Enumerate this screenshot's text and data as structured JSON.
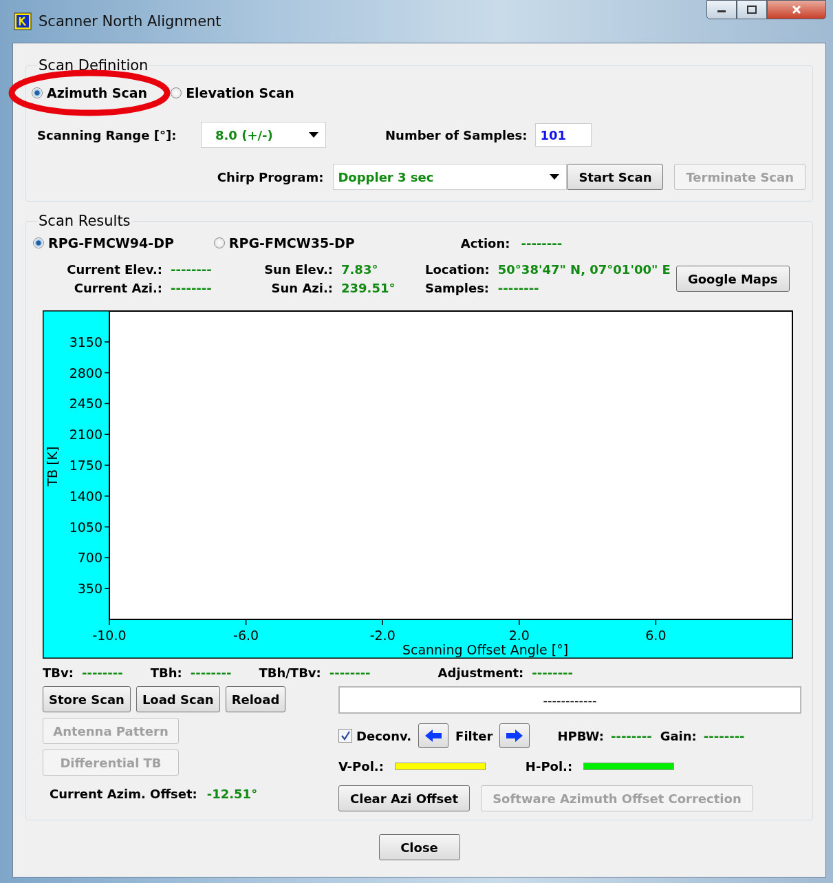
{
  "window": {
    "title": "Scanner North Alignment"
  },
  "highlight": {
    "kind": "ellipse"
  },
  "scan_definition": {
    "title": "Scan Definition",
    "scan_types": [
      {
        "label": "Azimuth Scan",
        "selected": true
      },
      {
        "label": "Elevation Scan",
        "selected": false
      }
    ],
    "scanning_range": {
      "label": "Scanning Range [°]:",
      "value": "8.0 (+/-)"
    },
    "samples": {
      "label": "Number of Samples:",
      "value": "101"
    },
    "chirp_program": {
      "label": "Chirp Program:",
      "value": "Doppler 3 sec"
    },
    "buttons": [
      {
        "label": "Start Scan",
        "disabled": false
      },
      {
        "label": "Terminate Scan",
        "disabled": true
      }
    ]
  },
  "scan_results": {
    "title": "Scan Results",
    "instruments": [
      {
        "label": "RPG-FMCW94-DP",
        "selected": true
      },
      {
        "label": "RPG-FMCW35-DP",
        "selected": false
      }
    ],
    "action": {
      "label": "Action:",
      "value": "--------"
    },
    "readout_rows": [
      [
        {
          "label": "Current Elev.:",
          "value": "--------"
        },
        {
          "label": "Sun Elev.:",
          "value": "7.83°"
        },
        {
          "label": "Location:",
          "value": "50°38'47\" N, 07°01'00\" E"
        }
      ],
      [
        {
          "label": "Current Azi.:",
          "value": "--------"
        },
        {
          "label": "Sun Azi.:",
          "value": "239.51°"
        },
        {
          "label": "Samples:",
          "value": "--------"
        }
      ]
    ],
    "maps_button": {
      "label": "Google Maps"
    },
    "chart_data": {
      "type": "line",
      "xlabel": "Scanning Offset Angle [°]",
      "ylabel": "TB [K]",
      "xlim": [
        -10,
        10
      ],
      "ylim": [
        0,
        3500
      ],
      "xticks": [
        {
          "value": -10,
          "label": "-10.0"
        },
        {
          "value": -6,
          "label": "-6.0"
        },
        {
          "value": -2,
          "label": "-2.0"
        },
        {
          "value": 2,
          "label": "2.0"
        },
        {
          "value": 6,
          "label": "6.0"
        }
      ],
      "yticks": [
        350,
        700,
        1050,
        1400,
        1750,
        2100,
        2450,
        2800,
        3150
      ]
    },
    "measurements": [
      {
        "label": "TBv:",
        "value": "--------"
      },
      {
        "label": "TBh:",
        "value": "--------"
      },
      {
        "label": "TBh/TBv:",
        "value": "--------"
      },
      {
        "label": "Adjustment:",
        "value": "--------"
      }
    ],
    "file_buttons": [
      {
        "label": "Store Scan"
      },
      {
        "label": "Load Scan"
      },
      {
        "label": "Reload"
      }
    ],
    "status": "------------",
    "side_buttons": [
      {
        "label": "Antenna Pattern",
        "disabled": true
      },
      {
        "label": "Differential TB",
        "disabled": true
      }
    ],
    "deconv": {
      "label": "Deconv.",
      "checked": true
    },
    "filter": {
      "label": "Filter"
    },
    "hpbw": {
      "label": "HPBW:",
      "value": "--------"
    },
    "gain": {
      "label": "Gain:",
      "value": "--------"
    },
    "polarizations": [
      {
        "label": "V-Pol.:",
        "color": "#ffff00"
      },
      {
        "label": "H-Pol.:",
        "color": "#00ee00"
      }
    ],
    "offset": {
      "label": "Current Azim. Offset:",
      "value": "-12.51°"
    },
    "offset_buttons": [
      {
        "label": "Clear Azi Offset",
        "disabled": false
      },
      {
        "label": "Software Azimuth Offset Correction",
        "disabled": true
      }
    ]
  },
  "close_button": {
    "label": "Close"
  }
}
